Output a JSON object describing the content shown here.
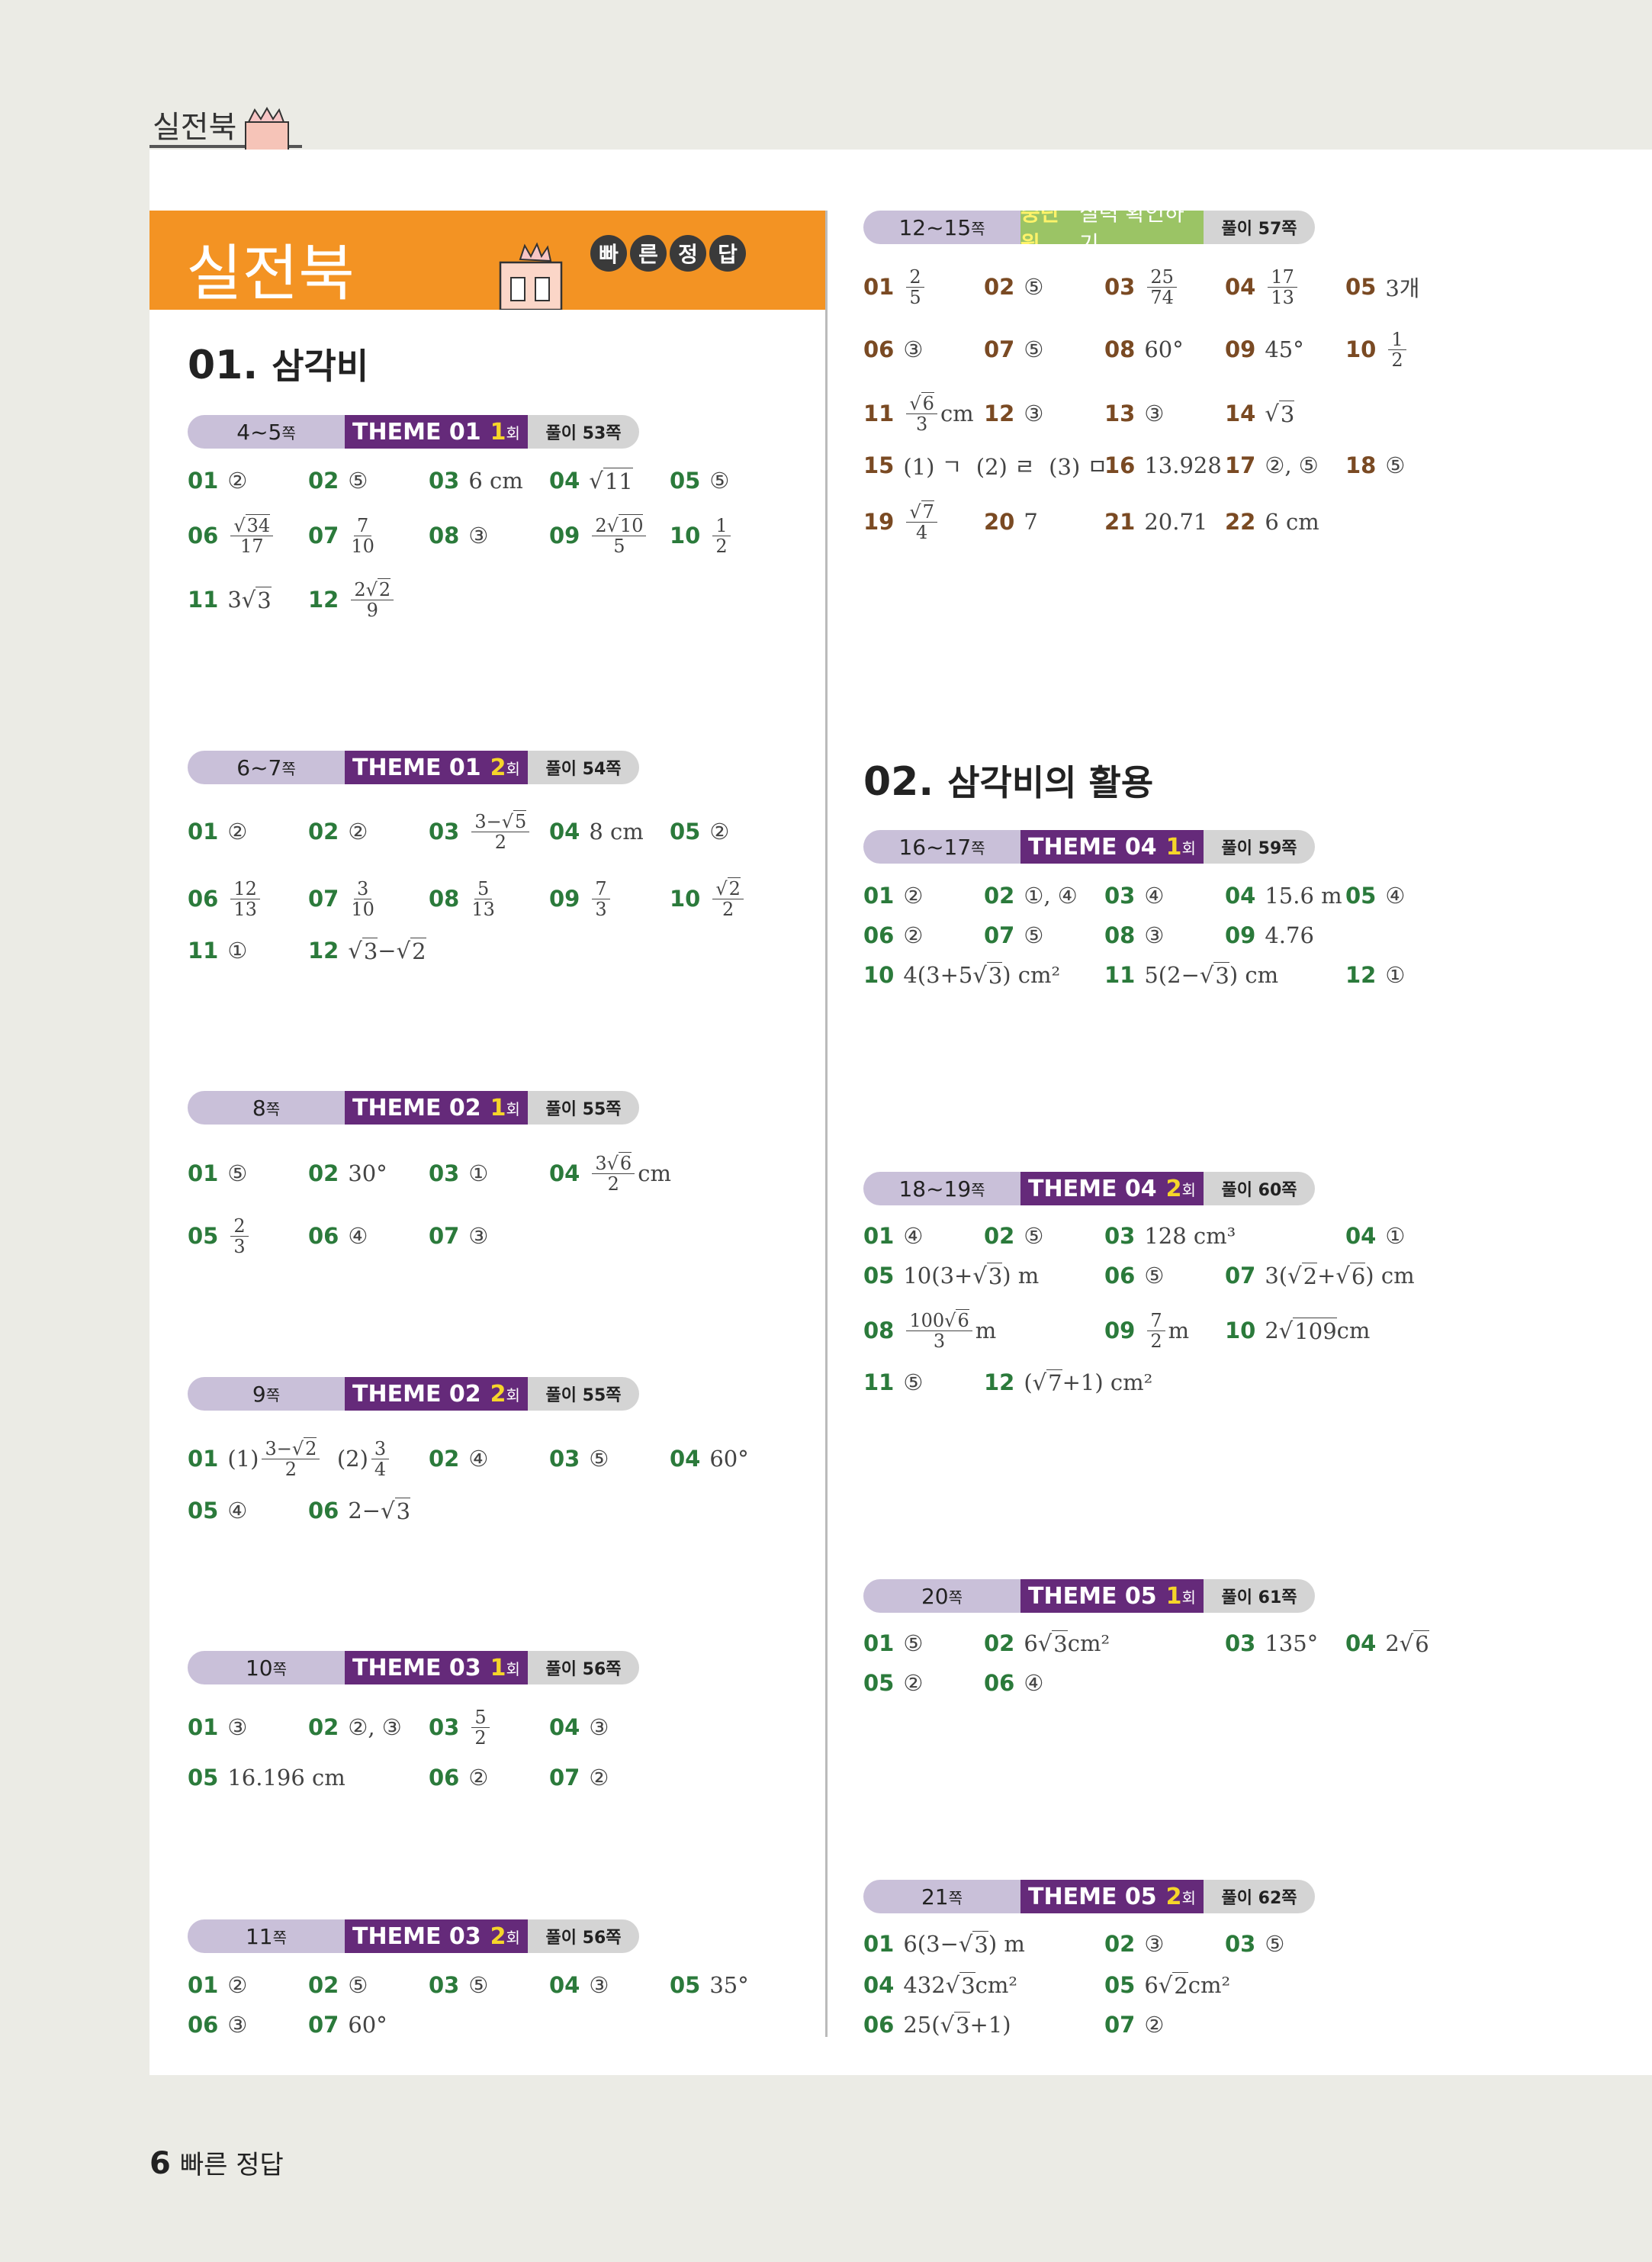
{
  "header": {
    "label": "실전북"
  },
  "banner": {
    "title": "실전북",
    "badge": [
      "빠",
      "른",
      "정",
      "답"
    ]
  },
  "units": {
    "u1": "01.",
    "u1t": "삼각비",
    "u2": "02.",
    "u2t": "삼각비의 활용"
  },
  "bars": {
    "b1": {
      "pg": "4~5",
      "th": "THEME 01",
      "n": "1",
      "sol": "풀이 53쪽"
    },
    "b2": {
      "pg": "6~7",
      "th": "THEME 01",
      "n": "2",
      "sol": "풀이 54쪽"
    },
    "b3": {
      "pg": "8",
      "th": "THEME 02",
      "n": "1",
      "sol": "풀이 55쪽"
    },
    "b4": {
      "pg": "9",
      "th": "THEME 02",
      "n": "2",
      "sol": "풀이 55쪽"
    },
    "b5": {
      "pg": "10",
      "th": "THEME 03",
      "n": "1",
      "sol": "풀이 56쪽"
    },
    "b6": {
      "pg": "11",
      "th": "THEME 03",
      "n": "2",
      "sol": "풀이 56쪽"
    },
    "r1": {
      "pg": "12~15",
      "mid_a": "중단원",
      "mid_b": " 실력 확인하기",
      "sol": "풀이 57쪽"
    },
    "r2": {
      "pg": "16~17",
      "th": "THEME 04",
      "n": "1",
      "sol": "풀이 59쪽"
    },
    "r3": {
      "pg": "18~19",
      "th": "THEME 04",
      "n": "2",
      "sol": "풀이 60쪽"
    },
    "r4": {
      "pg": "20",
      "th": "THEME 05",
      "n": "1",
      "sol": "풀이 61쪽"
    },
    "r5": {
      "pg": "21",
      "th": "THEME 05",
      "n": "2",
      "sol": "풀이 62쪽"
    }
  },
  "unit_suffix": {
    "jjok": "쪽",
    "hoe": "회"
  },
  "footer": {
    "page": "6",
    "label": "빠른 정답"
  }
}
